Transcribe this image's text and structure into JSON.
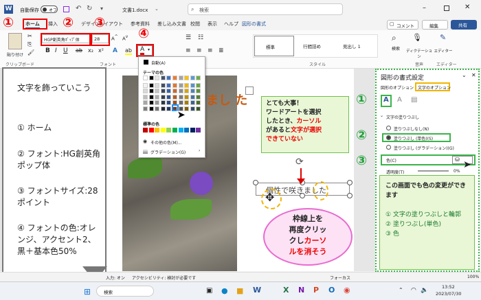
{
  "titlebar": {
    "autosave": "自動保存",
    "toggle": "オフ",
    "filename": "文書1.docx",
    "search": "検索"
  },
  "tabs": [
    "ホーム",
    "挿入",
    "デザイン",
    "レイアウト",
    "参考資料",
    "差し込み文書",
    "校閲",
    "表示",
    "ヘルプ",
    "図形の書式"
  ],
  "ribbon": {
    "comment": "コメント",
    "edit": "編集",
    "share": "共有",
    "paste": "貼り付け",
    "clipboard": "クリップボード",
    "font_name": "HGP創英角ﾎﾟｯﾌﾟ体",
    "font_size": "28",
    "font_group": "フォント",
    "style_group": "スタイル",
    "style1": "標準",
    "style2": "行間詰め",
    "style3": "見出し 1",
    "search_btn": "検索",
    "dictate": "ディクテーション",
    "editor": "エディター",
    "voice": "音声",
    "editor_group": "エディター"
  },
  "color_menu": {
    "auto": "自動(A)",
    "theme_title": "テーマの色",
    "std_title": "標準の色",
    "other": "その他の色(M)...",
    "gradient": "グラデーション(G)"
  },
  "left_note": {
    "title": "文字を飾っていこう",
    "i1": "① ホーム",
    "i2": "② フォント:HG創英角ポップ体",
    "i3": "③ フォントサイズ:28ポイント",
    "i4": "④ フォントの色:オレンジ、アクセント2、黒＋基本色50%"
  },
  "badges": {
    "b1": "①",
    "b2": "②",
    "b3": "③",
    "b4": "④"
  },
  "document": {
    "wordart_text": "まし た",
    "textbox_text": "個性で咲きました"
  },
  "callout_green": {
    "l1": "とても大事！",
    "l2": "ワードアートを選択",
    "l3": "したとき、",
    "l3r": "カーソル",
    "l4": "があると",
    "l4r": "文字が選択",
    "l5": "できていない"
  },
  "callout_pink": {
    "l1": "枠線上を",
    "l2": "再度クリッ",
    "l3": "クし",
    "l3r": "カーソ",
    "l4": "ルを消そう"
  },
  "pane": {
    "title": "図形の書式設定",
    "tab1": "図形のオプション",
    "tab2": "文字のオプション",
    "section": "文字の塗りつぶし",
    "opt1": "塗りつぶしなし(N)",
    "opt2": "塗りつぶし (単色)(S)",
    "opt3": "塗りつぶし (グラデーション)(G)",
    "color": "色(C)",
    "transparency": "透明度(T)",
    "pct": "0%",
    "badge1": "①",
    "badge2": "②",
    "badge3": "③"
  },
  "pane_note": {
    "l1": "この画面でも色の変更ができます",
    "l2": "① 文字の塗りつぶしと輪郭",
    "l3": "② 塗りつぶし(単色)",
    "l4": "③ 色"
  },
  "status": {
    "input": "入力: オン",
    "access": "アクセシビリティ: 検討が必要です",
    "focus": "フォーカス",
    "zoom": "100%"
  },
  "taskbar": {
    "search": "検索",
    "time": "13:52",
    "date": "2023/07/30"
  },
  "colors": {
    "accent": "#2b579a",
    "red": "#e00000",
    "green": "#22a03a",
    "orange": "#c55a11"
  }
}
